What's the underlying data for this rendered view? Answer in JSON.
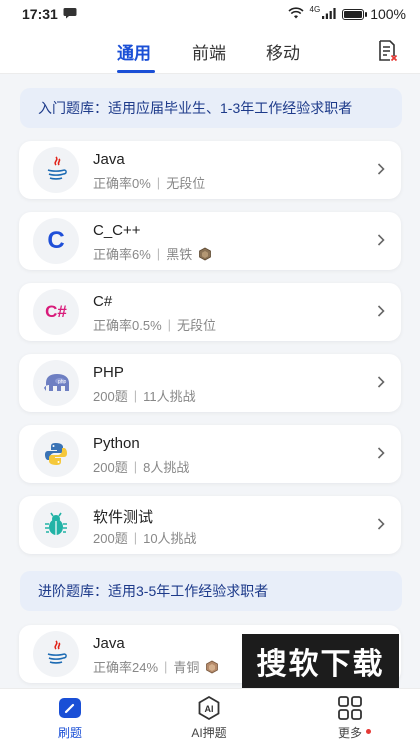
{
  "status_bar": {
    "time": "17:31",
    "network": "4G",
    "battery": "100%",
    "battery_level": 1.0
  },
  "tabs": [
    {
      "label": "通用",
      "active": true
    },
    {
      "label": "前端",
      "active": false
    },
    {
      "label": "移动",
      "active": false
    }
  ],
  "section_entry": {
    "label": "入门题库：适用应届毕业生、1-3年工作经验求职者"
  },
  "entry_items": [
    {
      "title": "Java",
      "stat": "正确率0%",
      "level": "无段位",
      "icon": "java-icon"
    },
    {
      "title": "C_C++",
      "stat": "正确率6%",
      "level": "黑铁",
      "icon": "c-icon"
    },
    {
      "title": "C#",
      "stat": "正确率0.5%",
      "level": "无段位",
      "icon": "csharp-icon"
    },
    {
      "title": "PHP",
      "stat": "200题",
      "level": "11人挑战",
      "icon": "php-elephant-icon"
    },
    {
      "title": "Python",
      "stat": "200题",
      "level": "8人挑战",
      "icon": "python-icon"
    },
    {
      "title": "软件测试",
      "stat": "200题",
      "level": "10人挑战",
      "icon": "bug-icon"
    }
  ],
  "section_advanced": {
    "label": "进阶题库：适用3-5年工作经验求职者"
  },
  "advanced_items": [
    {
      "title": "Java",
      "stat": "正确率24%",
      "level": "青铜",
      "icon": "java-icon"
    }
  ],
  "watermark": "搜软下载",
  "bottom_nav": [
    {
      "label": "刷题",
      "active": true,
      "icon": "practice-icon"
    },
    {
      "label": "AI押题",
      "active": false,
      "icon": "ai-icon"
    },
    {
      "label": "更多",
      "active": false,
      "icon": "grid-icon"
    }
  ],
  "colors": {
    "accent": "#1a4fd6",
    "section_bg": "#e8eef9",
    "page_bg": "#f3f5f8"
  }
}
